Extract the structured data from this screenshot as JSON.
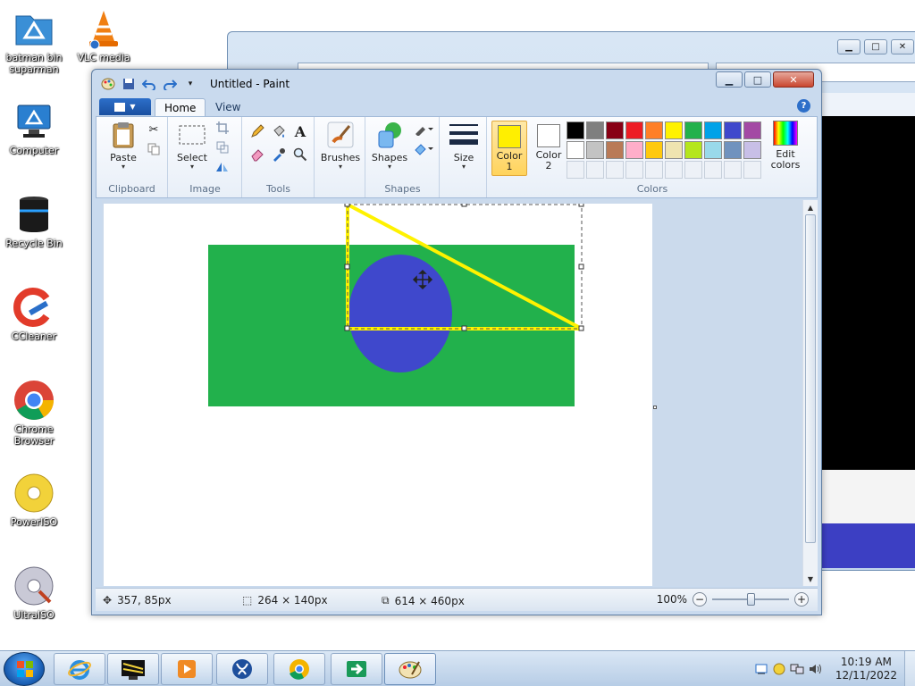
{
  "desktop": {
    "icons": [
      {
        "label": "batman bin suparman"
      },
      {
        "label": "VLC media"
      },
      {
        "label": "Computer"
      },
      {
        "label": "Recycle Bin"
      },
      {
        "label": "CCleaner"
      },
      {
        "label": "Chrome Browser"
      },
      {
        "label": "PowerISO"
      },
      {
        "label": "UltraISO"
      }
    ]
  },
  "paint": {
    "title": "Untitled - Paint",
    "tabs": [
      "Home",
      "View"
    ],
    "help_label": "?",
    "window_buttons": {
      "minimize": "▁",
      "maximize": "□",
      "close": "✕"
    },
    "groups": {
      "clipboard": {
        "label": "Clipboard",
        "paste": "Paste"
      },
      "image": {
        "label": "Image",
        "select": "Select"
      },
      "tools": {
        "label": "Tools",
        "text_tool": "A"
      },
      "brushes": {
        "label": "Brushes"
      },
      "shapes": {
        "label": "Shapes",
        "shapes_btn": "Shapes"
      },
      "size": {
        "label": "Size"
      },
      "colors": {
        "label": "Colors",
        "color1": "Color\n1",
        "color2": "Color\n2",
        "edit": "Edit colors",
        "color1_value": "#ffef00",
        "color2_value": "#ffffff",
        "palette": [
          "#000000",
          "#7f7f7f",
          "#880015",
          "#ed1c24",
          "#ff7f27",
          "#fff200",
          "#22b14c",
          "#00a2e8",
          "#3f48cc",
          "#a349a4",
          "#ffffff",
          "#c3c3c3",
          "#b97a57",
          "#ffaec9",
          "#ffc90e",
          "#efe4b0",
          "#b5e61d",
          "#99d9ea",
          "#7092be",
          "#c8bfe7",
          "",
          "",
          "",
          "",
          "",
          "",
          "",
          "",
          "",
          ""
        ]
      }
    },
    "status": {
      "cursor_pos": "357, 85px",
      "selection_size": "264 × 140px",
      "image_size": "614 × 460px",
      "zoom": "100%",
      "zoom_level": 1.0
    },
    "canvas_colors": {
      "green": "#22b14c",
      "blue": "#3f48cc",
      "yellow": "#fff200"
    }
  },
  "taskbar": {
    "time": "10:19 AM",
    "date": "12/11/2022"
  }
}
